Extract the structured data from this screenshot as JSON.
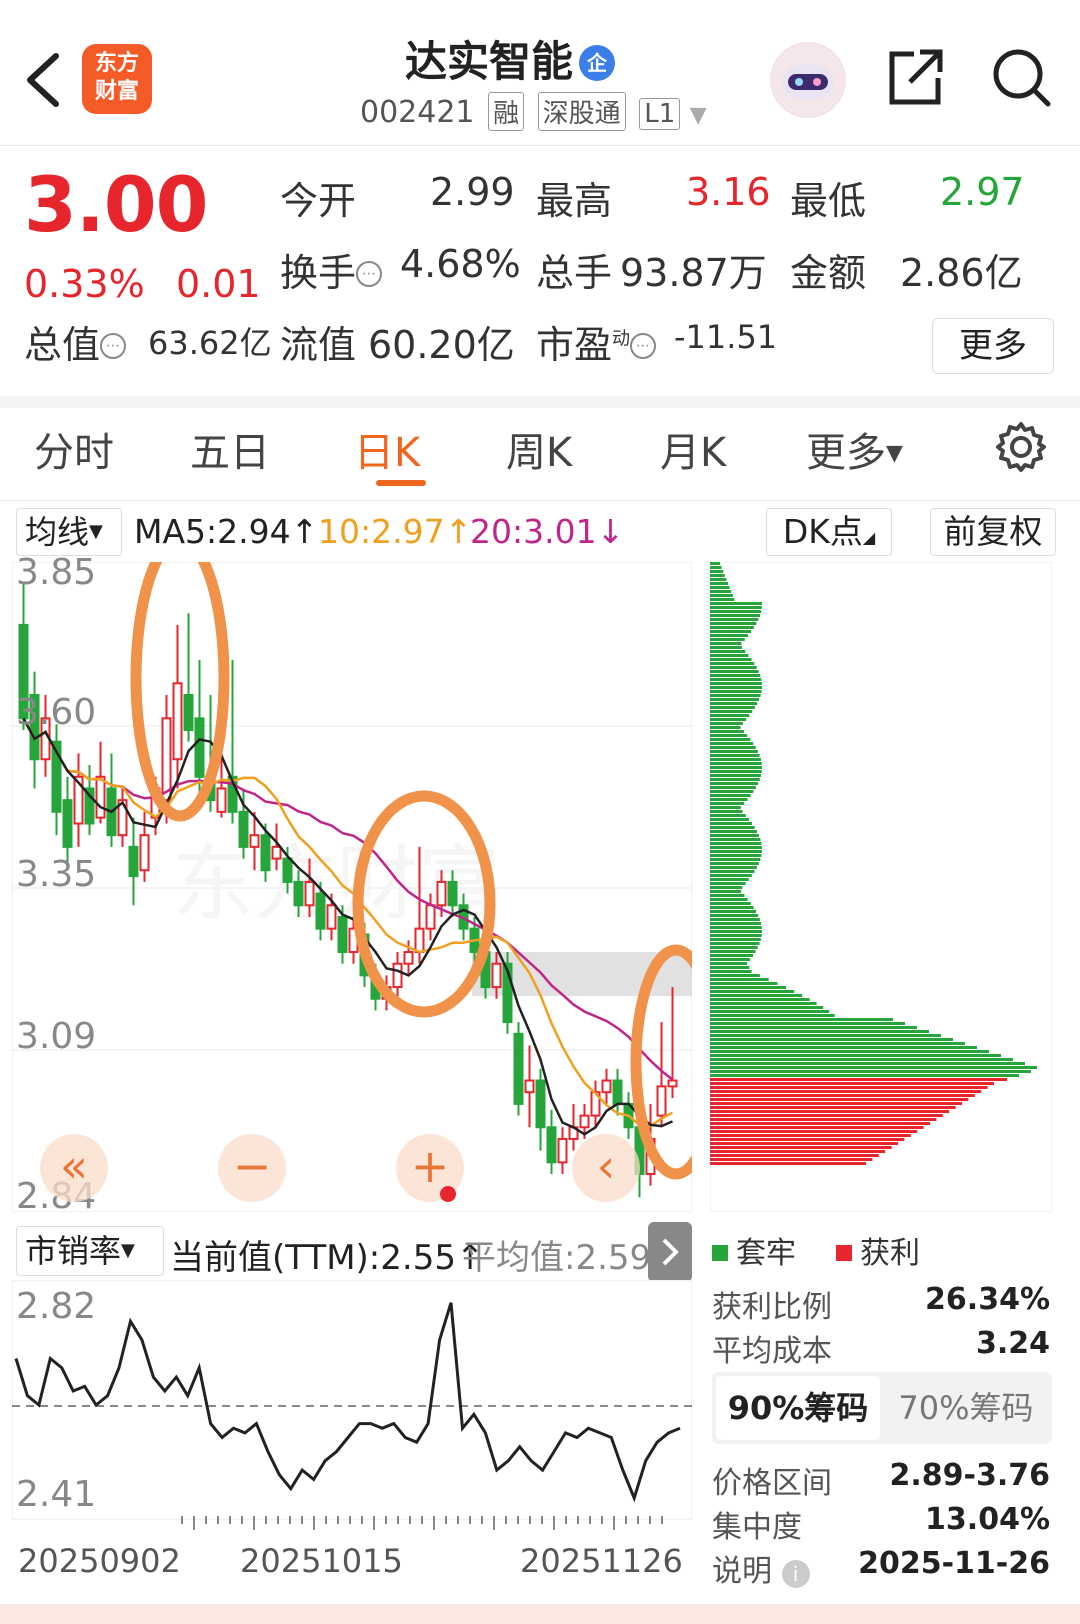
{
  "header": {
    "app_logo_text_1": "东方",
    "app_logo_text_2": "财富",
    "stock_name": "达实智能",
    "badge": "企",
    "code": "002421",
    "tags": [
      "融",
      "深股通",
      "L1"
    ]
  },
  "quote": {
    "price": "3.00",
    "change_pct": "0.33%",
    "change_amt": "0.01",
    "open_label": "今开",
    "open": "2.99",
    "high_label": "最高",
    "high": "3.16",
    "low_label": "最低",
    "low": "2.97",
    "turnover_label": "换手",
    "turnover": "4.68%",
    "volume_label": "总手",
    "volume": "93.87万",
    "amount_label": "金额",
    "amount": "2.86亿",
    "mktcap_label": "总值",
    "mktcap": "63.62亿",
    "float_label": "流值",
    "float_cap": "60.20亿",
    "pe_label": "市盈",
    "pe_sup": "动",
    "pe": "-11.51",
    "more_label": "更多"
  },
  "tabs": [
    "分时",
    "五日",
    "日K",
    "周K",
    "月K",
    "更多"
  ],
  "active_tab": "日K",
  "ma_bar": {
    "selector": "均线",
    "ma5": "MA5:2.94",
    "ma10": "10:2.97",
    "ma20": "20:3.01",
    "dk_button": "DK点",
    "adjust_button": "前复权"
  },
  "kline": {
    "price_axis": [
      "3.85",
      "3.60",
      "3.35",
      "3.09",
      "2.84"
    ],
    "controls": [
      "«",
      "−",
      "+",
      "‹",
      "›"
    ]
  },
  "chip_panel": {
    "legend_trapped": "套牢",
    "legend_profit": "获利",
    "profit_ratio_label": "获利比例",
    "profit_ratio": "26.34%",
    "avg_cost_label": "平均成本",
    "avg_cost": "3.24",
    "tab_90": "90%筹码",
    "tab_70": "70%筹码",
    "range_label": "价格区间",
    "range": "2.89-3.76",
    "concentration_label": "集中度",
    "concentration": "13.04%",
    "note_label": "说明",
    "note_date": "2025-11-26"
  },
  "sub_chart": {
    "selector": "市销率",
    "current": "当前值(TTM):2.55",
    "avg": "平均值:2.59",
    "axis": [
      "2.82",
      "2.41"
    ],
    "dates": [
      "20250902",
      "20251015",
      "20251126"
    ]
  },
  "colors": {
    "up": "#e6252d",
    "down": "#25a53a",
    "accent": "#f0661e",
    "ma5": "#222222",
    "ma10": "#f0a020",
    "ma20": "#c0268a",
    "highlight_circle": "#f0924a"
  }
}
